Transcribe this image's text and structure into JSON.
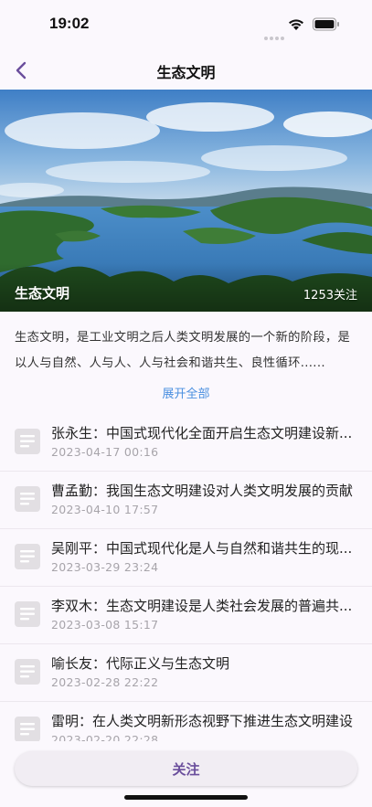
{
  "status_bar": {
    "time": "19:02"
  },
  "nav": {
    "title": "生态文明"
  },
  "hero": {
    "title": "生态文明",
    "followers": "1253关注"
  },
  "intro": {
    "text": "生态文明，是工业文明之后人类文明发展的一个新的阶段，是以人与自然、人与人、人与社会和谐共生、良性循环......",
    "expand_label": "展开全部"
  },
  "articles": [
    {
      "title": "张永生：中国式现代化全面开启生态文明建设新...",
      "date": "2023-04-17 00:16"
    },
    {
      "title": "曹孟勤：我国生态文明建设对人类文明发展的贡献",
      "date": "2023-04-10 17:57"
    },
    {
      "title": "吴刚平：中国式现代化是人与自然和谐共生的现...",
      "date": "2023-03-29 23:24"
    },
    {
      "title": "李双木：生态文明建设是人类社会发展的普遍共...",
      "date": "2023-03-08 15:17"
    },
    {
      "title": "喻长友：代际正义与生态文明",
      "date": "2023-02-28 22:22"
    },
    {
      "title": "雷明：在人类文明新形态视野下推进生态文明建设",
      "date": "2023-02-20 22:28"
    }
  ],
  "bottom": {
    "follow_label": "关注"
  },
  "colors": {
    "accent": "#6a4e9c",
    "link": "#4a8fe0",
    "background": "#fbf8fd"
  }
}
